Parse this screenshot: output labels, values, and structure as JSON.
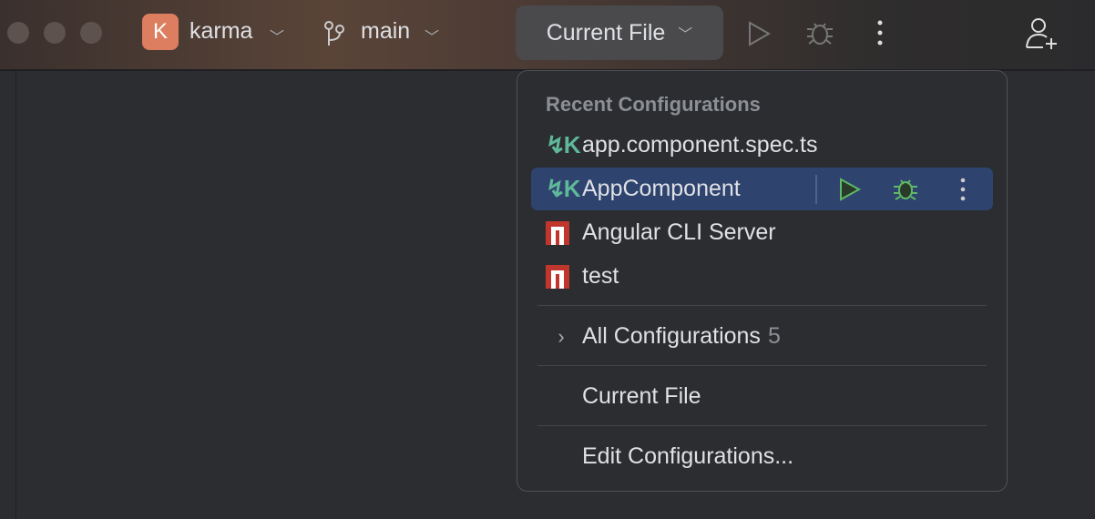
{
  "toolbar": {
    "project_initial": "K",
    "project": "karma",
    "branch": "main",
    "run_config": "Current File"
  },
  "popup": {
    "header": "Recent Configurations",
    "recent": [
      {
        "label": "app.component.spec.ts",
        "icon": "karma-icon"
      },
      {
        "label": "AppComponent",
        "icon": "karma-icon",
        "selected": true
      },
      {
        "label": "Angular CLI Server",
        "icon": "npm-icon"
      },
      {
        "label": "test",
        "icon": "npm-icon"
      }
    ],
    "all_configurations": "All Configurations",
    "all_count": "5",
    "current_file": "Current File",
    "edit": "Edit Configurations..."
  },
  "colors": {
    "selection": "#2e436e",
    "run_green": "#5fb865",
    "karma": "#5fb89a",
    "npm": "#c0362c"
  }
}
